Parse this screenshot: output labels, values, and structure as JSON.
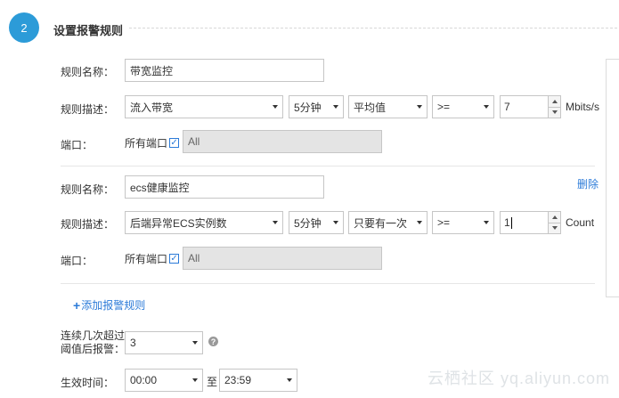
{
  "step": {
    "number": "2",
    "title": "设置报警规则"
  },
  "rules": [
    {
      "name_label": "规则名称：",
      "name_value": "带宽监控",
      "desc_label": "规则描述：",
      "metric": "流入带宽",
      "period": "5分钟",
      "stat": "平均值",
      "operator": ">=",
      "threshold": "7",
      "unit": "Mbits/s",
      "port_label": "端口：",
      "all_ports_label": "所有端口",
      "all_ports_checked": true,
      "port_value": "All"
    },
    {
      "delete_label": "删除",
      "name_label": "规则名称：",
      "name_value": "ecs健康监控",
      "desc_label": "规则描述：",
      "metric": "后端异常ECS实例数",
      "period": "5分钟",
      "stat": "只要有一次",
      "operator": ">=",
      "threshold": "1",
      "unit": "Count",
      "port_label": "端口：",
      "all_ports_label": "所有端口",
      "all_ports_checked": true,
      "port_value": "All"
    }
  ],
  "add_rule": {
    "plus": "+",
    "label": "添加报警规则"
  },
  "consecutive": {
    "label_line1": "连续几次超过",
    "label_line2": "阈值后报警：",
    "value": "3",
    "help": "?"
  },
  "effective_time": {
    "label": "生效时间：",
    "start": "00:00",
    "separator": "至",
    "end": "23:59"
  },
  "watermark": "云栖社区 yq.aliyun.com",
  "colors": {
    "accent": "#2c9bd8",
    "link": "#2c7bd8"
  }
}
